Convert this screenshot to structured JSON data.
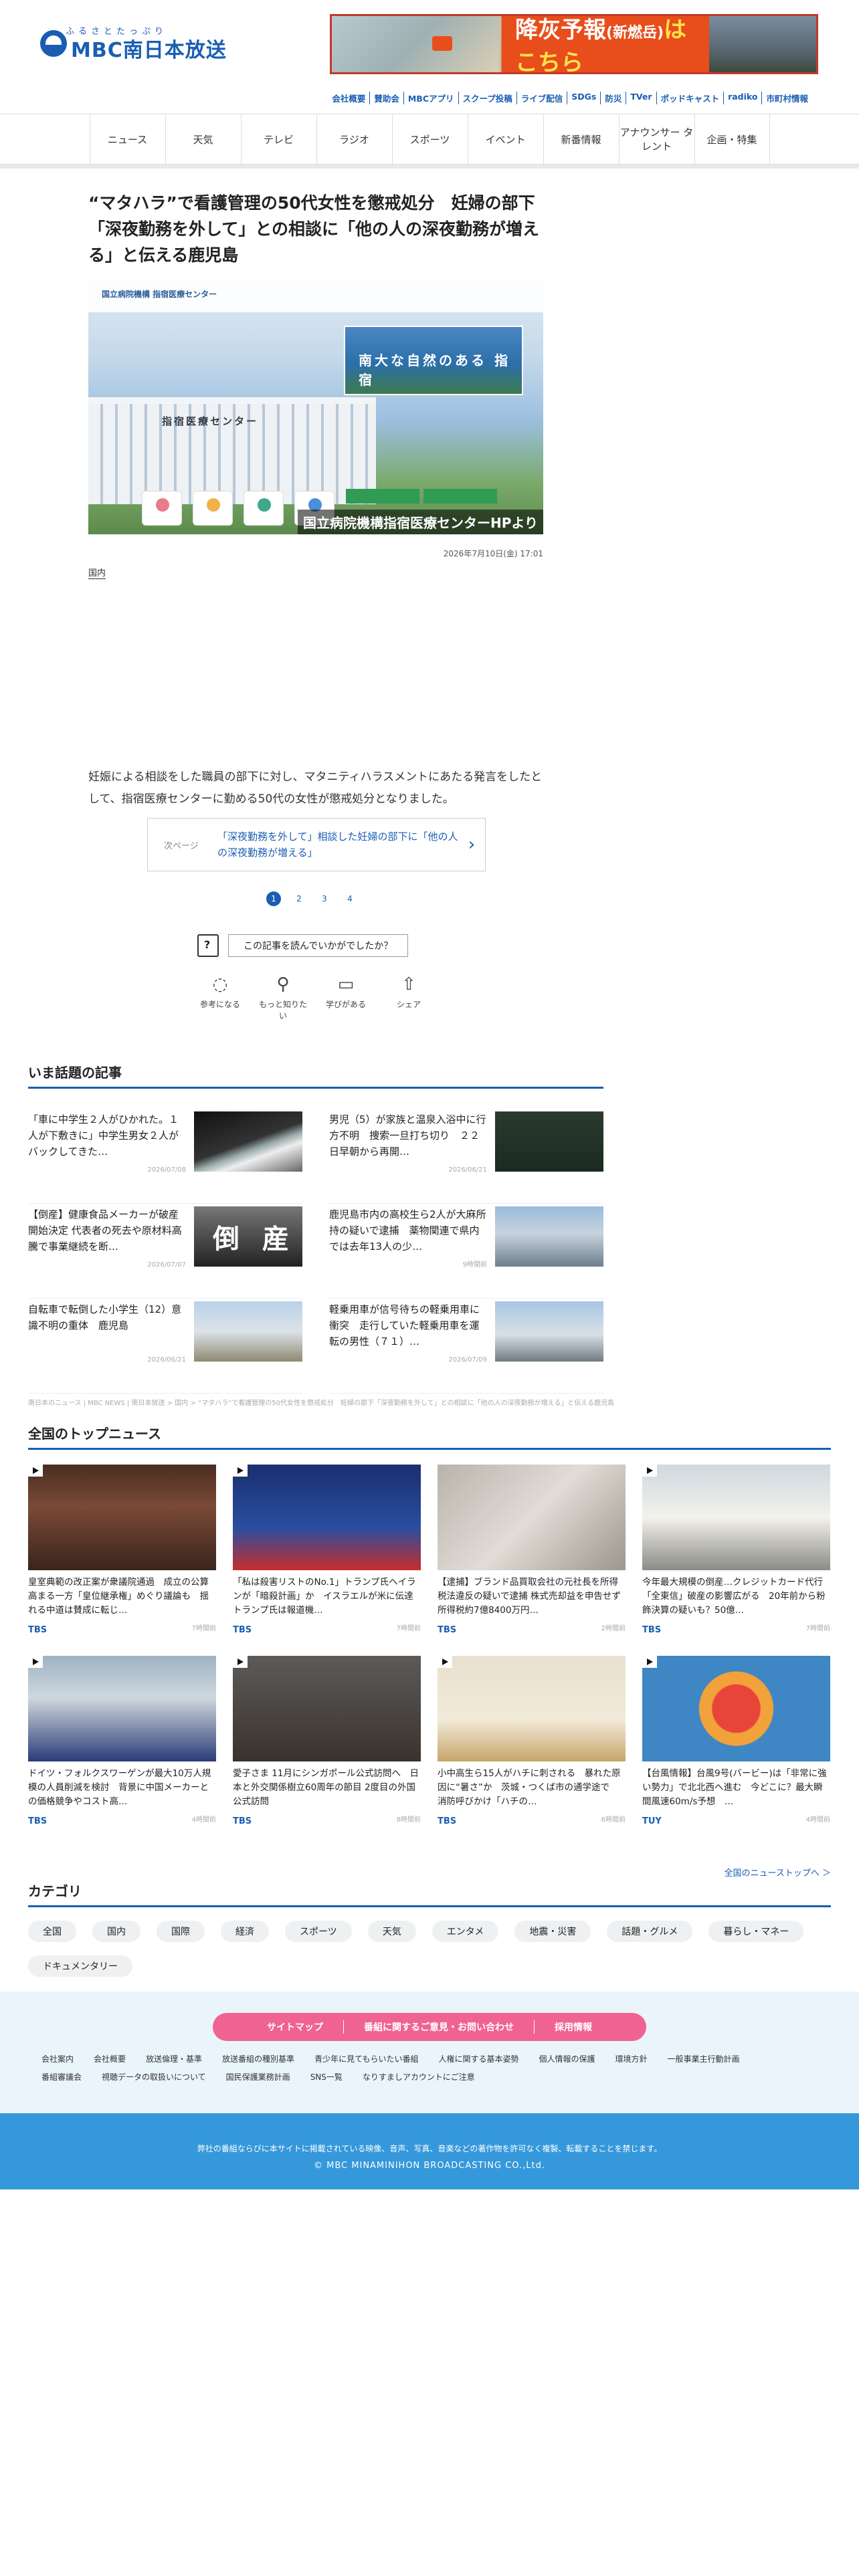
{
  "brand": {
    "kana": "ふるさとたっぷり",
    "name": "MBC南日本放送"
  },
  "banner": {
    "main": "降灰予報",
    "sub": "(新燃岳)",
    "cta": "はこちら"
  },
  "util_links": [
    "会社概要",
    "賛助会",
    "MBCアプリ",
    "スクープ投稿",
    "ライブ配信",
    "SDGs",
    "防災",
    "TVer",
    "ポッドキャスト",
    "radiko",
    "市町村情報"
  ],
  "nav": [
    "ニュース",
    "天気",
    "テレビ",
    "ラジオ",
    "スポーツ",
    "イベント",
    "新番情報",
    "アナウンサー タレント",
    "企画・特集"
  ],
  "article": {
    "title": "“マタハラ”で看護管理の50代女性を懲戒処分　妊婦の部下「深夜勤務を外して」との相談に「他の人の深夜勤務が増える」と伝える鹿児島",
    "hero_brand": "国立病院機構 指宿医療センター",
    "hero_island": "南大な自然のある 指宿",
    "hero_sign": "指宿医療センター",
    "hero_caption": "国立病院機構指宿医療センターHPより",
    "date": "2026年7月10日(金) 17:01",
    "tag": "国内",
    "body": "妊娠による相談をした職員の部下に対し、マタニティハラスメントにあたる発言をしたとして、指宿医療センターに勤める50代の女性が懲戒処分となりました。"
  },
  "next": {
    "label": "次ページ",
    "title": "「深夜勤務を外して」相談した妊婦の部下に「他の人の深夜勤務が増える」"
  },
  "pager": [
    "1",
    "2",
    "3",
    "4"
  ],
  "feedback": {
    "prompt": "この記事を読んでいかがでしたか？",
    "reactions": [
      {
        "icon": "lightbulb-icon",
        "label": "参考になる"
      },
      {
        "icon": "magnifier-icon",
        "label": "もっと知りたい"
      },
      {
        "icon": "book-icon",
        "label": "学びがある"
      },
      {
        "icon": "share-icon",
        "label": "シェア"
      }
    ]
  },
  "trending": {
    "title": "いま話題の記事",
    "items": [
      {
        "title": "「車に中学生２人がひかれた。１人が下敷きに」中学生男女２人がバックしてきた…",
        "date": "2026/07/08"
      },
      {
        "title": "男児（5）が家族と温泉入浴中に行方不明　捜索一旦打ち切り　２２日早朝から再開…",
        "date": "2026/06/21"
      },
      {
        "title": "【倒産】健康食品メーカーが破産開始決定 代表者の死去や原材料高騰で事業継続を断…",
        "date": "2026/07/07",
        "thumb_text": "倒 産"
      },
      {
        "title": "鹿児島市内の高校生ら2人が大麻所持の疑いで逮捕　薬物関連で県内では去年13人の少…",
        "date": "9時間前"
      },
      {
        "title": "自転車で転倒した小学生（12）意識不明の重体　鹿児島",
        "date": "2026/06/21"
      },
      {
        "title": "軽乗用車が信号待ちの軽乗用車に衝突　走行していた軽乗用車を運転の男性（７１）…",
        "date": "2026/07/09"
      }
    ]
  },
  "breadcrumb": "南日本のニュース | MBC NEWS | 南日本放送 > 国内 > “マタハラ”で看護管理の50代女性を懲戒処分　妊婦の部下「深夜勤務を外して」との相談に「他の人の深夜勤務が増える」と伝える鹿児島",
  "national": {
    "title": "全国のトップニュース",
    "items": [
      {
        "title": "皇室典範の改正案が衆議院通過　成立の公算高まる一方「皇位継承権」めぐり議論も　揺れる中道は賛成に転じ…",
        "src": "TBS",
        "time": "7時間前"
      },
      {
        "title": "「私は殺害リストのNo.1」トランプ氏へイランが「暗殺計画」か　イスラエルが米に伝達　トランプ氏は報道機…",
        "src": "TBS",
        "time": "7時間前"
      },
      {
        "title": "【逮捕】ブランド品買取会社の元社長を所得税法違反の疑いで逮捕 株式売却益を申告せず所得税約7億8400万円…",
        "src": "TBS",
        "time": "2時間前"
      },
      {
        "title": "今年最大規模の倒産…クレジットカード代行「全東信」破産の影響広がる　20年前から粉飾決算の疑いも？50億…",
        "src": "TBS",
        "time": "7時間前"
      },
      {
        "title": "ドイツ・フォルクスワーゲンが最大10万人規模の人員削減を検討　背景に中国メーカーとの価格競争やコスト高…",
        "src": "TBS",
        "time": "4時間前"
      },
      {
        "title": "愛子さま 11月にシンガポール公式訪問へ　日本と外交関係樹立60周年の節目 2度目の外国公式訪問",
        "src": "TBS",
        "time": "8時間前"
      },
      {
        "title": "小中高生ら15人がハチに刺される　暴れた原因に“暑さ”か　茨城・つくば市の通学途で　消防呼びかけ「ハチの…",
        "src": "TBS",
        "time": "6時間前"
      },
      {
        "title": "【台風情報】台風9号(バービー)は「非常に強い勢力」で北北西へ進む　今どこに？最大瞬間風速60m/s予想　…",
        "src": "TUY",
        "time": "4時間前"
      }
    ],
    "more": "全国のニューストップへ ＞"
  },
  "categories": {
    "title": "カテゴリ",
    "items": [
      "全国",
      "国内",
      "国際",
      "経済",
      "スポーツ",
      "天気",
      "エンタメ",
      "地震・災害",
      "話題・グルメ",
      "暮らし・マネー",
      "ドキュメンタリー"
    ]
  },
  "footer": {
    "buttons": [
      "サイトマップ",
      "番組に関するご意見・お問い合わせ",
      "採用情報"
    ],
    "links": [
      "会社案内",
      "会社概要",
      "放送倫理・基準",
      "放送番組の種別基準",
      "青少年に見てもらいたい番組",
      "人権に関する基本姿勢",
      "個人情報の保護",
      "環境方針",
      "一般事業主行動計画",
      "番組審議会",
      "視聴データの取扱いについて",
      "国民保護業務計画",
      "SNS一覧",
      "なりすましアカウントにご注意"
    ],
    "note": "弊社の番組ならびに本サイトに掲載されている映像、音声、写真、音楽などの著作物を許可なく複製、転載することを禁じます。",
    "copyright": "© MBC MINAMINIHON BROADCASTING CO.,Ltd."
  }
}
